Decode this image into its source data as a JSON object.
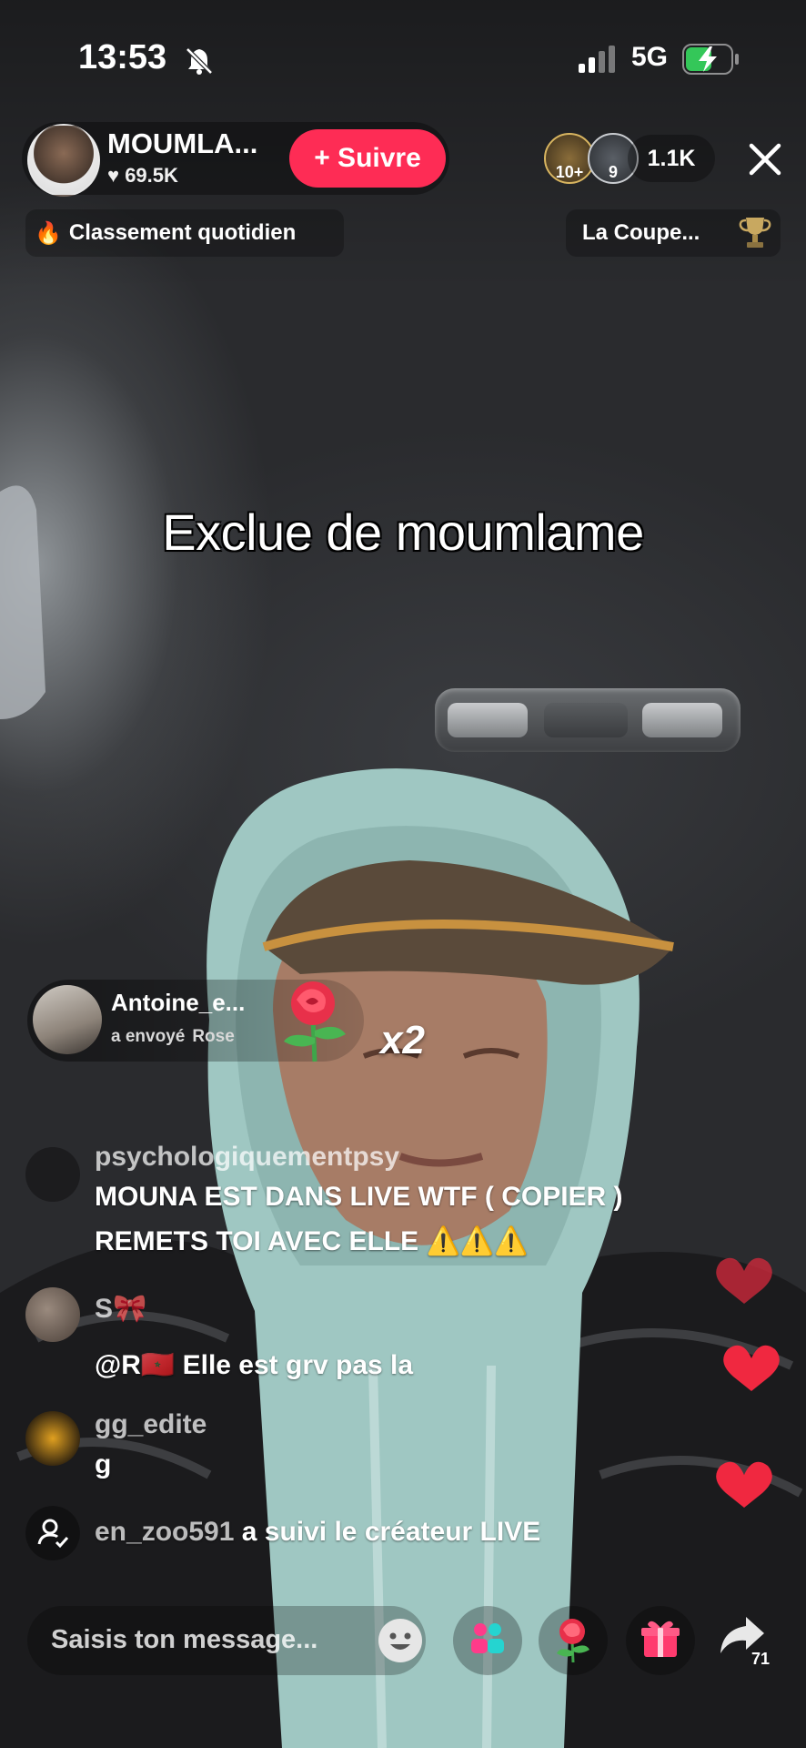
{
  "status_bar": {
    "time": "13:53",
    "network": "5G"
  },
  "host": {
    "name": "MOUMLA...",
    "likes": "69.5K",
    "follow_label": "+ Suivre"
  },
  "badges": {
    "first": "10+",
    "second": "9"
  },
  "viewers": "1.1K",
  "ranking": {
    "label": "Classement quotidien"
  },
  "cup": {
    "label": "La Coupe..."
  },
  "caption": "Exclue de moumlame",
  "gift": {
    "user": "Antoine_e...",
    "action": "a envoyé",
    "item": "Rose",
    "count": "x2"
  },
  "chat": [
    {
      "user": "psychologiquementpsy",
      "line1": "MOUNA EST DANS LIVE WTF ( COPIER )",
      "line2": "REMETS TOI AVEC ELLE ⚠️⚠️⚠️"
    },
    {
      "user": "S🎀",
      "line1": "@R🇲🇦 Elle est grv pas la"
    },
    {
      "user": "gg_edite",
      "line1": "g"
    }
  ],
  "follow_event": {
    "user": "en_zoo591",
    "action": "a suivi le créateur LIVE"
  },
  "input": {
    "placeholder": "Saisis ton message..."
  },
  "share_count": "71",
  "colors": {
    "follow": "#fe2c55",
    "heart": "#e8283c"
  }
}
